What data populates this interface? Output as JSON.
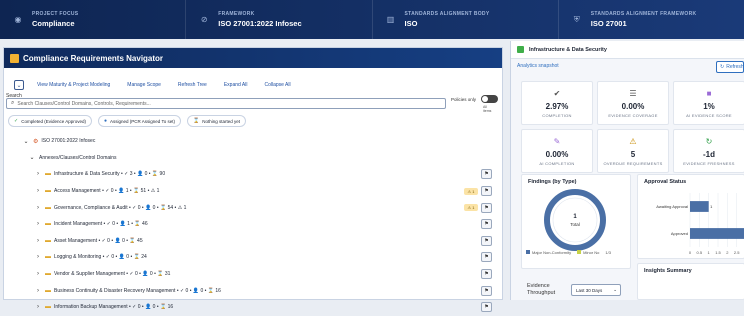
{
  "banner": [
    {
      "label": "PROJECT FOCUS",
      "value": "Compliance",
      "icon": "lightbulb-icon"
    },
    {
      "label": "FRAMEWORK",
      "value": "ISO 27001:2022 Infosec",
      "icon": "link-icon"
    },
    {
      "label": "STANDARDS ALIGNMENT BODY",
      "value": "ISO",
      "icon": "building-icon"
    },
    {
      "label": "STANDARDS ALIGNMENT FRAMEWORK",
      "value": "ISO 27001",
      "icon": "shield-icon"
    }
  ],
  "navigator": {
    "title": "Compliance Requirements Navigator",
    "toolbar": [
      "View Maturity & Project Modeling",
      "Manage Scope",
      "Refresh Tree",
      "Expand All",
      "Collapse All"
    ],
    "search_label": "Search",
    "search_placeholder": "Search Clauses/Control Domains, Controls, Requirements...",
    "policies_only": "Policies only",
    "all_items": "All items",
    "legend": [
      {
        "label": "Completed (Evidence Approved)",
        "icon": "check-icon"
      },
      {
        "label": "Assigned (PCR Assigned To set)",
        "icon": "person-icon"
      },
      {
        "label": "Nothing started yet",
        "icon": "hourglass-icon"
      }
    ],
    "tree_root": "ISO 27001:2022 Infosec",
    "tree_group": "Annexes/Clauses/Control Domains",
    "tree_items": [
      {
        "label": "Infrastructure & Data Security • ✓ 3 • 👤 0 • ⌛ 90",
        "warn": ""
      },
      {
        "label": "Access Management • ✓ 0 • 👤 1 • ⌛ 51 • ⚠ 1",
        "warn": "⚠ 1"
      },
      {
        "label": "Governance, Compliance & Audit • ✓ 0 • 👤 0 • ⌛ 54 • ⚠ 1",
        "warn": "⚠ 1"
      },
      {
        "label": "Incident Management • ✓ 0 • 👤 1 • ⌛ 46",
        "warn": ""
      },
      {
        "label": "Asset Management • ✓ 0 • 👤 0 • ⌛ 45",
        "warn": ""
      },
      {
        "label": "Logging & Monitoring • ✓ 0 • 👤 0 • ⌛ 24",
        "warn": ""
      },
      {
        "label": "Vendor & Supplier Management • ✓ 0 • 👤 0 • ⌛ 31",
        "warn": ""
      },
      {
        "label": "Business Continuity & Disaster Recovery Management • ✓ 0 • 👤 0 • ⌛ 16",
        "warn": ""
      },
      {
        "label": "Information Backup Management • ✓ 0 • 👤 0 • ⌛ 16",
        "warn": ""
      }
    ]
  },
  "analytics": {
    "title": "Infrastructure & Data Security",
    "snapshot": "Analytics snapshot",
    "refresh": "Refresh",
    "metrics": [
      {
        "value": "2.97%",
        "label": "COMPLETION",
        "icon": "check-circle-icon"
      },
      {
        "value": "0.00%",
        "label": "EVIDENCE COVERAGE",
        "icon": "list-icon"
      },
      {
        "value": "1%",
        "label": "AI EVIDENCE SCORE",
        "icon": "ai-square-icon"
      },
      {
        "value": "0.00%",
        "label": "AI COMPLETION",
        "icon": "ai-pen-icon"
      },
      {
        "value": "5",
        "label": "OVERDUE REQUIREMENTS",
        "icon": "warning-icon"
      },
      {
        "value": "-1d",
        "label": "EVIDENCE FRESHNESS",
        "icon": "refresh-icon"
      }
    ],
    "findings_title": "Findings (by Type)",
    "findings_center_value": "1",
    "findings_center_label": "Total",
    "findings_legend": [
      "Major Non-Conformity",
      "Minor No",
      "1/3"
    ],
    "approval_title": "Approval Status",
    "insights_title": "Insights Summary",
    "evidence_label": "Evidence Throughput",
    "evidence_select": "Last 30 Days"
  },
  "chart_data": {
    "type": "bar",
    "title": "Approval Status",
    "categories": [
      "Awaiting Approval",
      "Approved"
    ],
    "values": [
      1,
      3
    ],
    "xlim": [
      0,
      3
    ],
    "xticks": [
      "0",
      "0.5",
      "1",
      "1.5",
      "2",
      "2.5",
      "3"
    ]
  }
}
